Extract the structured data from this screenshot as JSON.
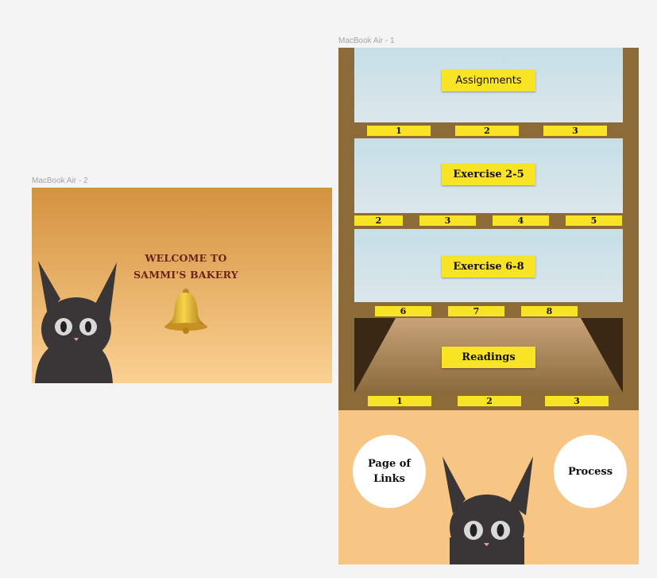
{
  "frames": {
    "frame1_label": "MacBook Air - 1",
    "frame2_label": "MacBook Air - 2"
  },
  "welcome": {
    "line1": "WELCOME TO",
    "line2": "SAMMI'S BAKERY"
  },
  "shelf": {
    "assignments": {
      "label": "Assignments",
      "tabs": [
        "1",
        "2",
        "3"
      ]
    },
    "exercise_2_5": {
      "label": "Exercise 2-5",
      "tabs": [
        "2",
        "3",
        "4",
        "5"
      ]
    },
    "exercise_6_8": {
      "label": "Exercise 6-8",
      "tabs": [
        "6",
        "7",
        "8"
      ]
    },
    "readings": {
      "label": "Readings",
      "tabs": [
        "1",
        "2",
        "3"
      ]
    }
  },
  "buttons": {
    "links_line1": "Page of",
    "links_line2": "Links",
    "process": "Process"
  },
  "colors": {
    "sign_yellow": "#f9e325",
    "shelf_wood": "#8c6b38",
    "cat": "#3a3536",
    "peach": "#f7c684"
  }
}
